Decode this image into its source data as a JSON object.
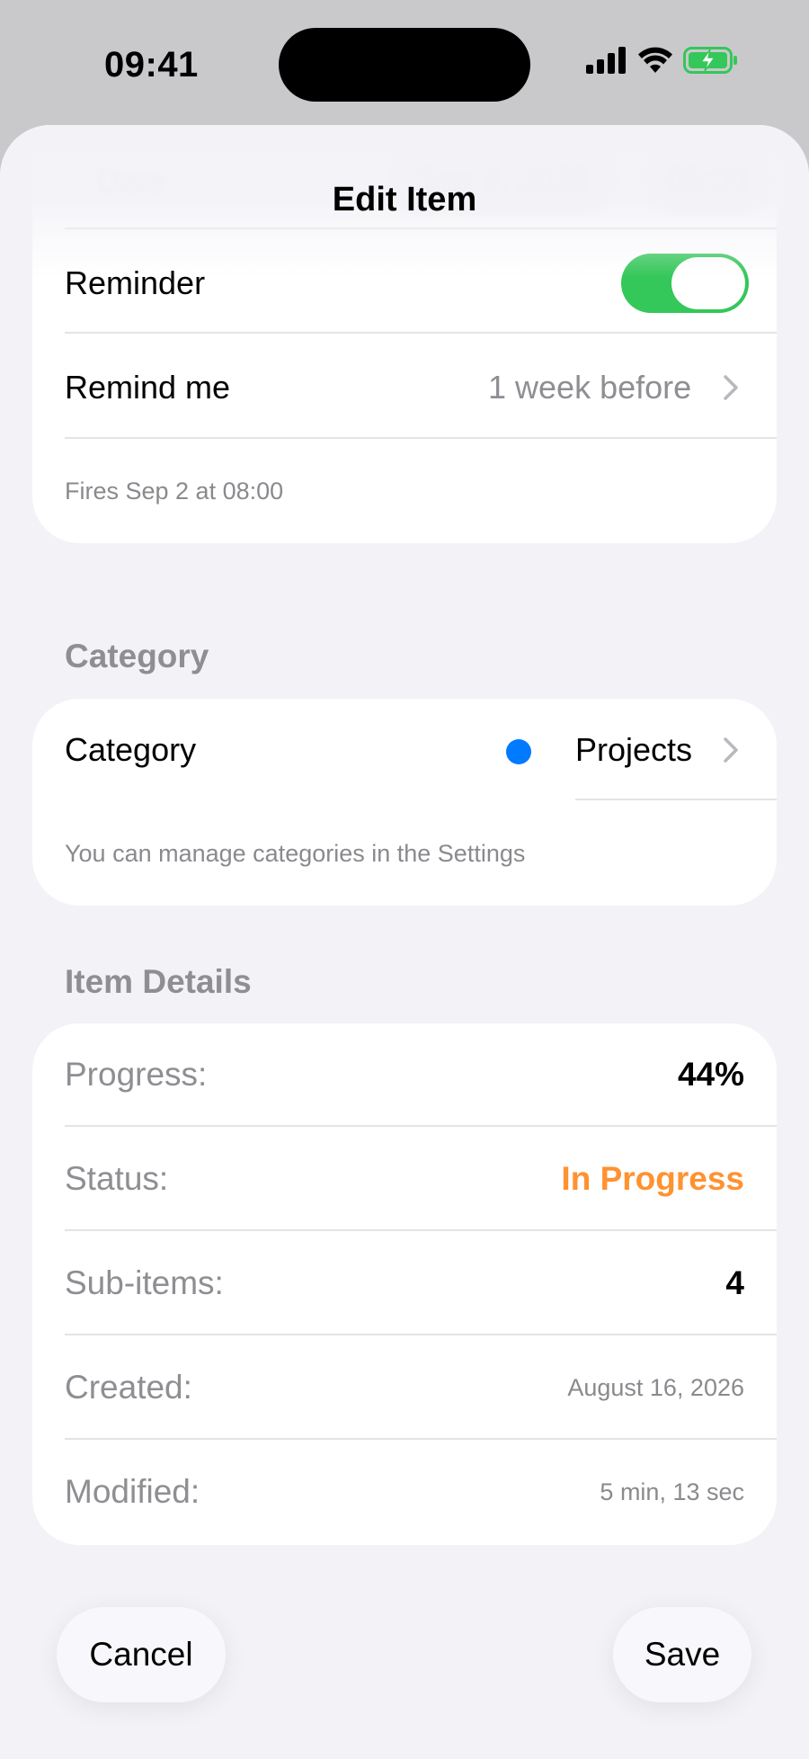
{
  "status_bar": {
    "time": "09:41"
  },
  "sheet": {
    "title": "Edit Item"
  },
  "date_row": {
    "label": "Date",
    "date": "Sep 9, 2026",
    "time": "08:00"
  },
  "reminder": {
    "label": "Reminder",
    "enabled": true
  },
  "remind_me": {
    "label": "Remind me",
    "value": "1 week before"
  },
  "fires_note": "Fires Sep 2 at 08:00",
  "category_section": {
    "header": "Category",
    "label": "Category",
    "value": "Projects",
    "dot_color": "#007aff",
    "footnote": "You can manage categories in the Settings"
  },
  "details_section": {
    "header": "Item Details",
    "rows": [
      {
        "label": "Progress:",
        "value": "44%"
      },
      {
        "label": "Status:",
        "value": "In Progress"
      },
      {
        "label": "Sub-items:",
        "value": "4"
      },
      {
        "label": "Created:",
        "value": "August 16, 2026"
      },
      {
        "label": "Modified:",
        "value": "5 min, 13 sec"
      }
    ]
  },
  "actions": {
    "cancel": "Cancel",
    "save": "Save"
  },
  "colors": {
    "toggle_on": "#34c759",
    "status_in_progress": "#ff9230",
    "accent_dot": "#007aff"
  }
}
